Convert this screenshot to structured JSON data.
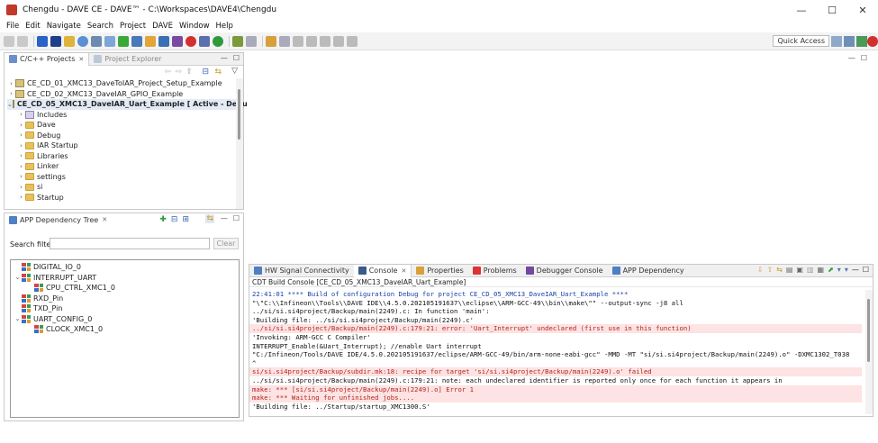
{
  "window": {
    "title": "Chengdu - DAVE CE - DAVE™ - C:\\Workspaces\\DAVE4\\Chengdu",
    "minimize": "—",
    "maximize": "☐",
    "close": "✕"
  },
  "menu": [
    "File",
    "Edit",
    "Navigate",
    "Search",
    "Project",
    "DAVE",
    "Window",
    "Help"
  ],
  "toolbar": {
    "quick_access": "Quick Access"
  },
  "projects_panel": {
    "tabs": [
      {
        "label": "C/C++ Projects"
      },
      {
        "label": "Project Explorer"
      }
    ],
    "tree": [
      {
        "label": "CE_CD_01_XMC13_DaveToIAR_Project_Setup_Example",
        "chevron": ">",
        "indent": 0,
        "icon": "project"
      },
      {
        "label": "CE_CD_02_XMC13_DaveIAR_GPIO_Example",
        "chevron": ">",
        "indent": 0,
        "icon": "project"
      },
      {
        "label": "CE_CD_05_XMC13_DaveIAR_Uart_Example [ Active - Debug ]",
        "chevron": "v",
        "indent": 0,
        "icon": "project",
        "bold": true
      },
      {
        "label": "Includes",
        "chevron": ">",
        "indent": 1,
        "icon": "includes"
      },
      {
        "label": "Dave",
        "chevron": ">",
        "indent": 1,
        "icon": "folder"
      },
      {
        "label": "Debug",
        "chevron": ">",
        "indent": 1,
        "icon": "folder"
      },
      {
        "label": "IAR Startup",
        "chevron": ">",
        "indent": 1,
        "icon": "folder"
      },
      {
        "label": "Libraries",
        "chevron": ">",
        "indent": 1,
        "icon": "folder"
      },
      {
        "label": "Linker",
        "chevron": ">",
        "indent": 1,
        "icon": "folder"
      },
      {
        "label": "settings",
        "chevron": ">",
        "indent": 1,
        "icon": "folder"
      },
      {
        "label": "si",
        "chevron": ">",
        "indent": 1,
        "icon": "folder"
      },
      {
        "label": "Startup",
        "chevron": ">",
        "indent": 1,
        "icon": "folder"
      }
    ]
  },
  "dependency_panel": {
    "tab": "APP Dependency Tree",
    "search_label": "Search filter",
    "search_value": "",
    "clear_button": "Clear",
    "tree": [
      {
        "label": "DIGITAL_IO_0",
        "chevron": "",
        "indent": 0
      },
      {
        "label": "INTERRUPT_UART",
        "chevron": "v",
        "indent": 0
      },
      {
        "label": "CPU_CTRL_XMC1_0",
        "chevron": "",
        "indent": 1
      },
      {
        "label": "RXD_Pin",
        "chevron": "",
        "indent": 0
      },
      {
        "label": "TXD_Pin",
        "chevron": "",
        "indent": 0
      },
      {
        "label": "UART_CONFIG_0",
        "chevron": "v",
        "indent": 0
      },
      {
        "label": "CLOCK_XMC1_0",
        "chevron": "",
        "indent": 1
      }
    ]
  },
  "bottom_panel": {
    "tabs": [
      {
        "label": "APP Dependency",
        "active": false
      },
      {
        "label": "HW Signal Connectivity",
        "active": false
      },
      {
        "label": "Console",
        "active": true
      },
      {
        "label": "Properties",
        "active": false
      },
      {
        "label": "Problems",
        "active": false
      },
      {
        "label": "Debugger Console",
        "active": false
      }
    ],
    "console_title": "CDT Build Console [CE_CD_05_XMC13_DaveIAR_Uart_Example]",
    "lines": [
      {
        "text": "22:41:01 **** Build of configuration Debug for project CE_CD_05_XMC13_DaveIAR_Uart_Example ****",
        "kind": "info"
      },
      {
        "text": "\"\\\"C:\\\\Infineon\\\\Tools\\\\DAVE IDE\\\\4.5.0.202105191637\\\\eclipse\\\\ARM-GCC-49\\\\bin\\\\make\\\"\" --output-sync -j8 all",
        "kind": "plain"
      },
      {
        "text": "../si/si.si4project/Backup/main(2249).c: In function 'main':",
        "kind": "plain"
      },
      {
        "text": "'Building file: ../si/si.si4project/Backup/main(2249).c'",
        "kind": "plain"
      },
      {
        "text": "../si/si.si4project/Backup/main(2249).c:179:21: error: 'Uart_Interrupt' undeclared (first use in this function)",
        "kind": "err"
      },
      {
        "text": "'Invoking: ARM-GCC C Compiler'",
        "kind": "plain"
      },
      {
        "text": "    INTERRUPT_Enable(&Uart_Interrupt);  //enable Uart interrupt",
        "kind": "plain"
      },
      {
        "text": "\"C:/Infineon/Tools/DAVE IDE/4.5.0.202105191637/eclipse/ARM-GCC-49/bin/arm-none-eabi-gcc\" -MMD -MT \"si/si.si4project/Backup/main(2249).o\" -DXMC1302_T038",
        "kind": "plain"
      },
      {
        "text": "                     ^",
        "kind": "plain"
      },
      {
        "text": "si/si.si4project/Backup/subdir.mk:18: recipe for target 'si/si.si4project/Backup/main(2249).o' failed",
        "kind": "err"
      },
      {
        "text": "../si/si.si4project/Backup/main(2249).c:179:21: note: each undeclared identifier is reported only once for each function it appears in",
        "kind": "plain"
      },
      {
        "text": "make: *** [si/si.si4project/Backup/main(2249).o] Error 1",
        "kind": "err"
      },
      {
        "text": "make: *** Waiting for unfinished jobs....",
        "kind": "err"
      },
      {
        "text": "'Building file: ../Startup/startup_XMC1300.S'",
        "kind": "plain"
      }
    ]
  },
  "colors": {
    "error_bg": "#fde3e3",
    "error_fg": "#b3261e",
    "info_fg": "#1a3fa8",
    "folder": "#e8c15a"
  }
}
